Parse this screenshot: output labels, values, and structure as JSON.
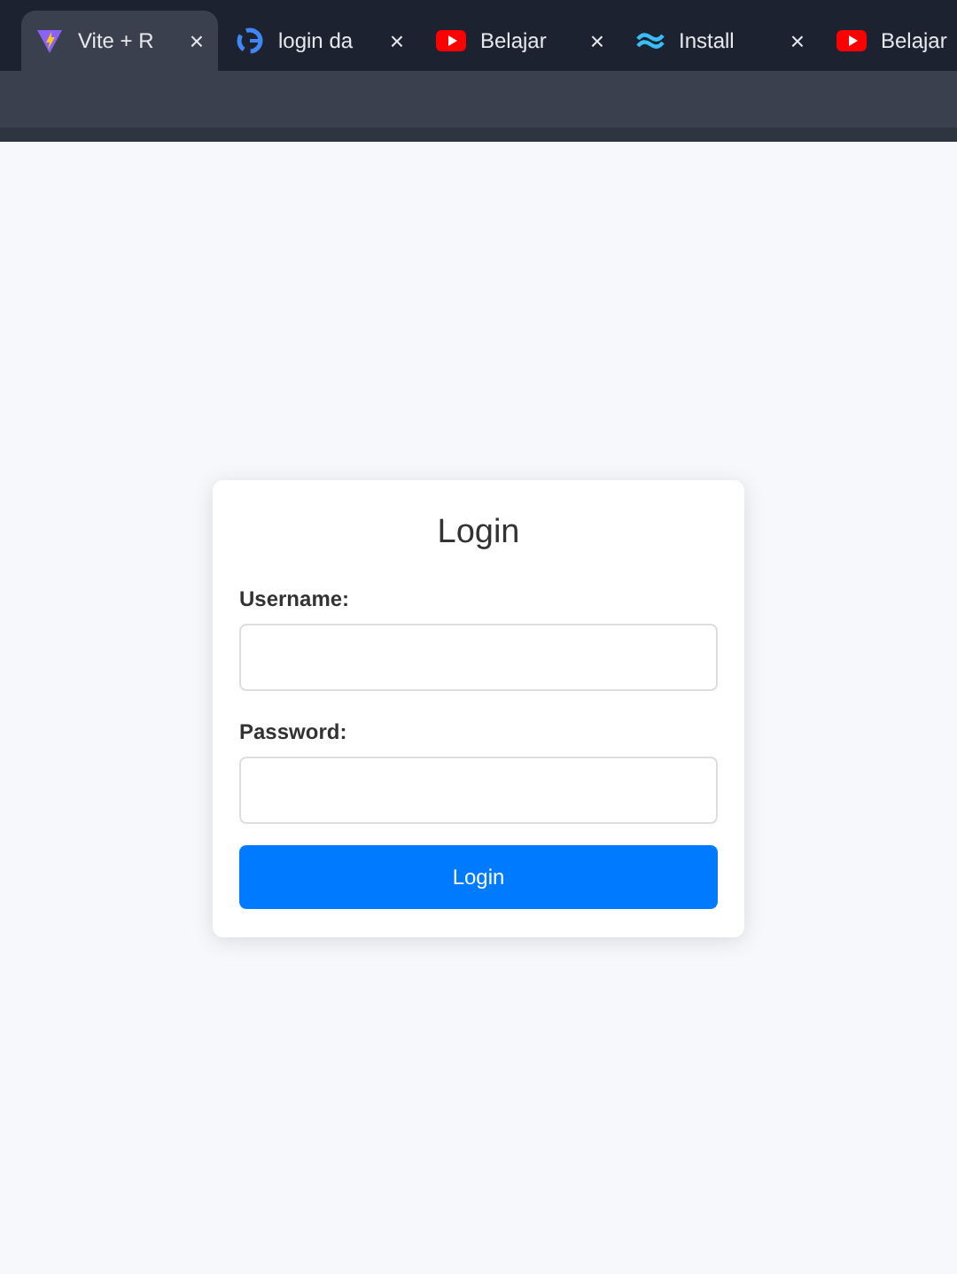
{
  "tabs": [
    {
      "kind": "vite",
      "title": "Vite + R",
      "close": "×",
      "selected": true
    },
    {
      "kind": "google",
      "title": "login da",
      "close": "×",
      "selected": false
    },
    {
      "kind": "youtube",
      "title": "Belajar",
      "close": "×",
      "selected": false
    },
    {
      "kind": "tailwind",
      "title": "Install",
      "close": "×",
      "selected": false
    },
    {
      "kind": "youtube",
      "title": "Belajar",
      "selected": false
    }
  ],
  "login": {
    "title": "Login",
    "fields": [
      {
        "label": "Username:"
      },
      {
        "label": "Password:"
      }
    ],
    "button": "Login"
  }
}
